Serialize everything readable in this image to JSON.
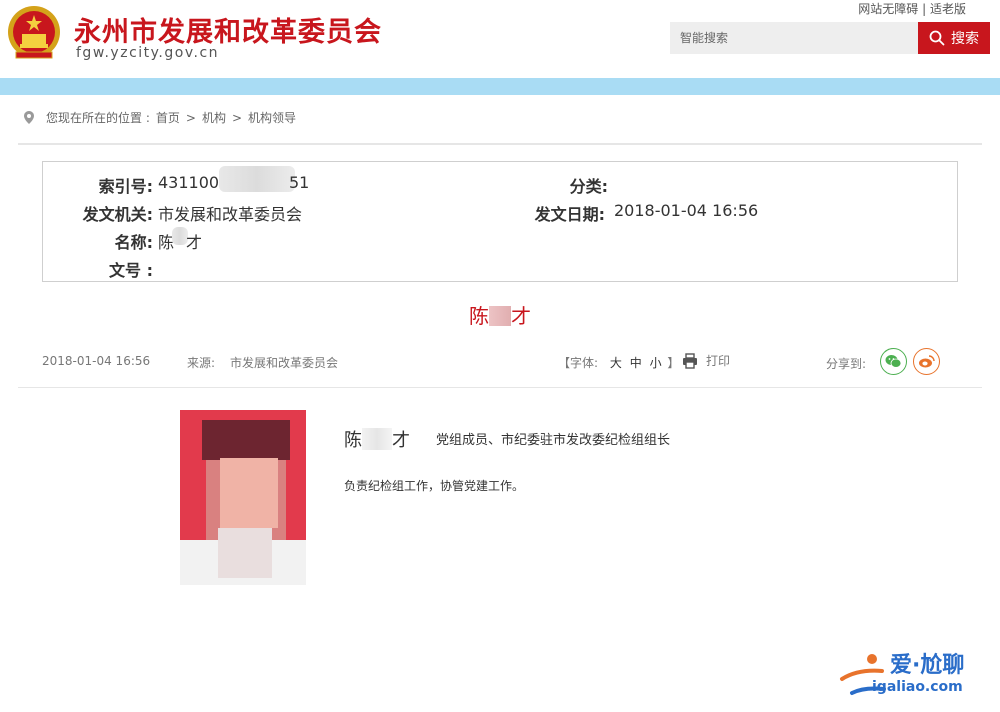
{
  "header": {
    "site_title": "永州市发展和改革委员会",
    "site_domain": "fgw.yzcity.gov.cn",
    "top_links": {
      "accessible": "网站无障碍",
      "separator": "|",
      "elderly": "适老版"
    },
    "search": {
      "placeholder": "智能搜索",
      "button_label": "搜索"
    }
  },
  "breadcrumb": {
    "prefix": "您现在所在的位置 :",
    "items": [
      "首页",
      "机构",
      "机构领导"
    ],
    "separator": ">"
  },
  "info": {
    "index_label": "索引号:",
    "index_value_start": "43110000",
    "index_value_end": "51",
    "category_label": "分类:",
    "category_value": "",
    "issuer_label": "发文机关:",
    "issuer_value": "市发展和改革委员会",
    "date_label": "发文日期:",
    "date_value": "2018-01-04 16:56",
    "name_label": "名称:",
    "name_value_start": "陈",
    "name_value_end": "才",
    "docno_label": "文号 :",
    "docno_value": ""
  },
  "article": {
    "title_start": "陈",
    "title_end": "才",
    "date": "2018-01-04 16:56",
    "source_label": "来源:",
    "source_value": "市发展和改革委员会",
    "font_label": "【字体:",
    "font_large": "大",
    "font_medium": "中",
    "font_small": "小",
    "font_close": "】",
    "print_label": "打印",
    "share_label": "分享到:"
  },
  "person": {
    "name_start": "陈",
    "name_end": "才",
    "role": "党组成员、市纪委驻市发改委纪检组组长",
    "duty": "负责纪检组工作，协管党建工作。"
  },
  "watermark": {
    "text": "爱·尬聊",
    "url": "igaliao.com"
  },
  "colors": {
    "brand_red": "#c8161d",
    "banner_blue": "#a9dcf4",
    "wechat_green": "#4caf50",
    "weibo_orange": "#e8732c"
  },
  "icons": {
    "emblem": "national-emblem-icon",
    "search": "search-icon",
    "location": "location-pin-icon",
    "print": "printer-icon",
    "wechat": "wechat-icon",
    "weibo": "weibo-icon"
  }
}
